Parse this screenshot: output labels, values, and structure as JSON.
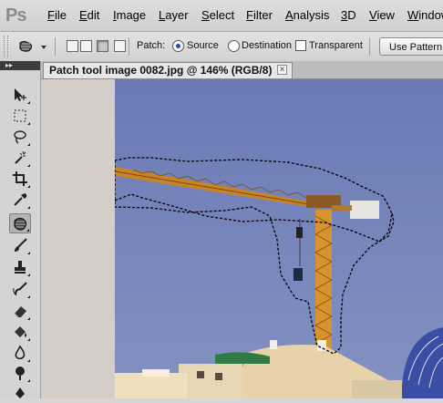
{
  "app": {
    "logo_text": "Ps"
  },
  "menu": [
    {
      "label": "File",
      "underline": "F",
      "rest": "ile"
    },
    {
      "label": "Edit",
      "underline": "E",
      "rest": "dit"
    },
    {
      "label": "Image",
      "underline": "I",
      "rest": "mage"
    },
    {
      "label": "Layer",
      "underline": "L",
      "rest": "ayer"
    },
    {
      "label": "Select",
      "underline": "S",
      "rest": "elect"
    },
    {
      "label": "Filter",
      "underline": "F",
      "rest": "ilter"
    },
    {
      "label": "Analysis",
      "underline": "A",
      "rest": "nalysis"
    },
    {
      "label": "3D",
      "underline": "3",
      "rest": "D"
    },
    {
      "label": "View",
      "underline": "V",
      "rest": "iew"
    },
    {
      "label": "Window",
      "underline": "W",
      "rest": "indow"
    }
  ],
  "options": {
    "patch_label": "Patch:",
    "source_label": "Source",
    "destination_label": "Destination",
    "transparent_label": "Transparent",
    "use_pattern_label": "Use Pattern",
    "patch_mode": "source",
    "transparent_checked": false
  },
  "toolbar": {
    "collapse_glyph": "▸▸",
    "active_tool": "patch-tool"
  },
  "document": {
    "tab_title": "Patch tool image 0082.jpg @ 146% (RGB/8)",
    "close_glyph": "×",
    "zoom_percent": 146
  },
  "colors": {
    "sky": "#7584b8",
    "crane": "#d08a24"
  }
}
